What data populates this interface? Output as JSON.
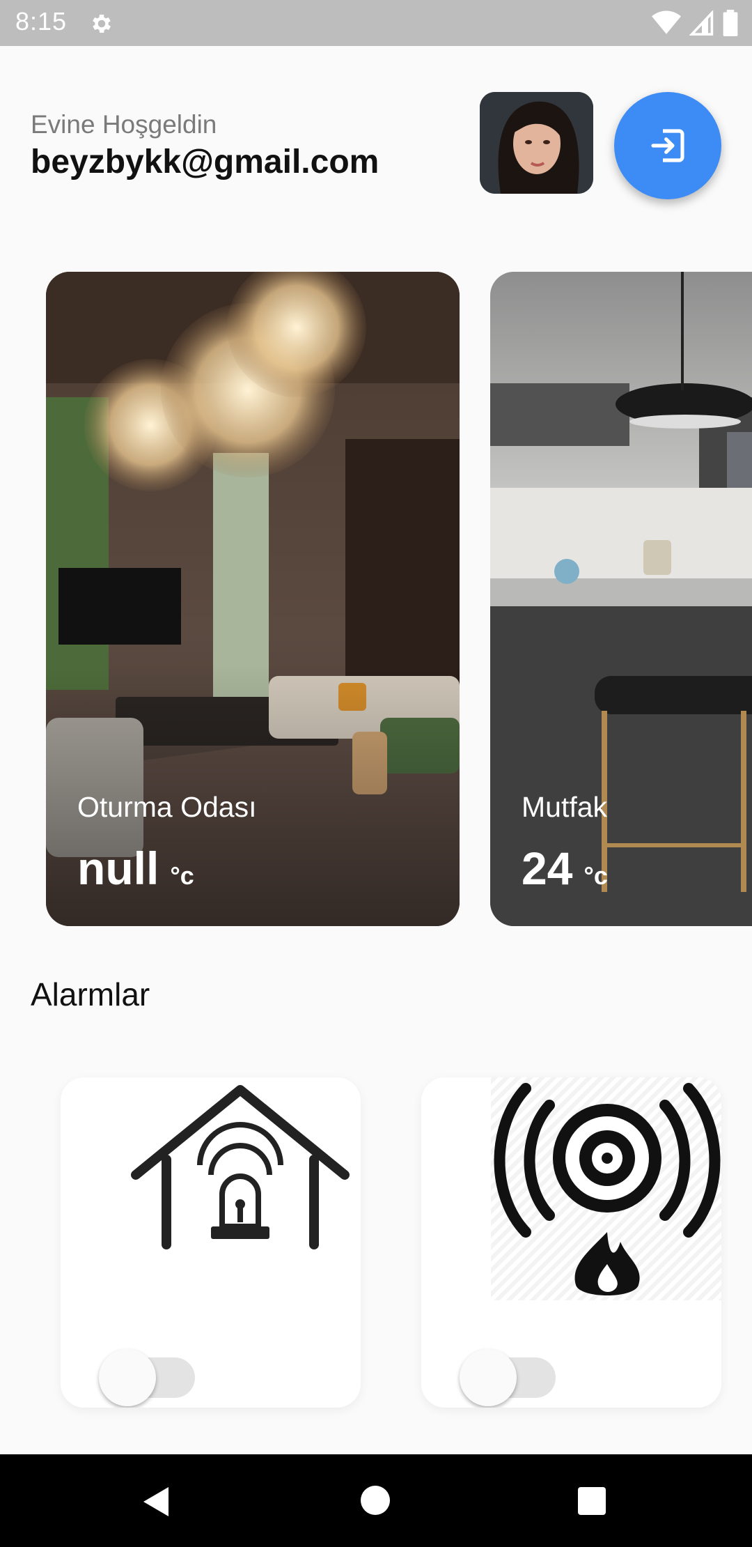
{
  "status_bar": {
    "time": "8:15",
    "icons": [
      "settings-gear-icon",
      "wifi-icon",
      "signal-icon",
      "battery-icon"
    ]
  },
  "header": {
    "greeting": "Evine Hoşgeldin",
    "email": "beyzbykk@gmail.com",
    "logout_icon": "logout-icon",
    "accent_color": "#3d8bf5"
  },
  "rooms": [
    {
      "name": "Oturma Odası",
      "temperature": "null",
      "unit": "°c"
    },
    {
      "name": "Mutfak",
      "temperature": "24",
      "unit": "°c"
    }
  ],
  "alarms_section": {
    "title": "Alarmlar",
    "items": [
      {
        "icon": "home-alarm-icon",
        "enabled": false
      },
      {
        "icon": "fire-alarm-icon",
        "enabled": false
      }
    ]
  },
  "nav_bar": {
    "icons": [
      "back-icon",
      "home-icon",
      "recents-icon"
    ]
  }
}
